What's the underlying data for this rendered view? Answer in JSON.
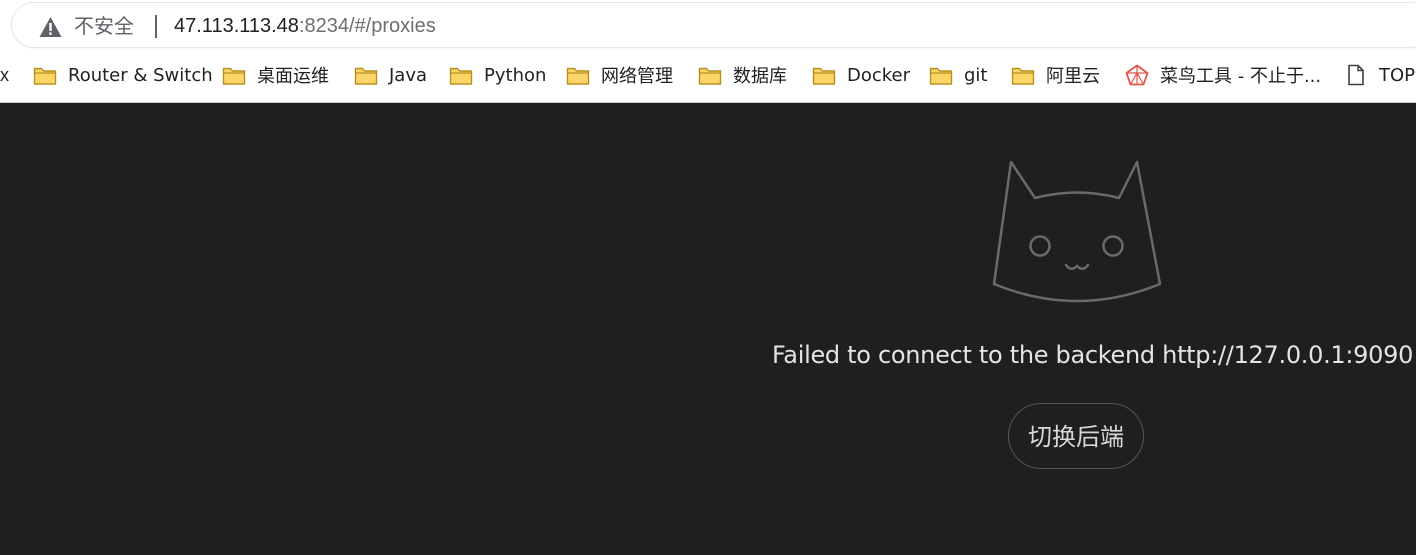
{
  "browser": {
    "security_label": "不安全",
    "url_host": "47.113.113.48",
    "url_rest": ":8234/#/proxies"
  },
  "bookmarks": {
    "leading_fragment": "x",
    "items": [
      {
        "label": "Router & Switch",
        "icon": "folder-icon"
      },
      {
        "label": "桌面运维",
        "icon": "folder-icon"
      },
      {
        "label": "Java",
        "icon": "folder-icon"
      },
      {
        "label": "Python",
        "icon": "folder-icon"
      },
      {
        "label": "网络管理",
        "icon": "folder-icon"
      },
      {
        "label": "数据库",
        "icon": "folder-icon"
      },
      {
        "label": "Docker",
        "icon": "folder-icon"
      },
      {
        "label": "git",
        "icon": "folder-icon"
      },
      {
        "label": "阿里云",
        "icon": "folder-icon"
      },
      {
        "label": "菜鸟工具 - 不止于...",
        "icon": "runoob-icon"
      },
      {
        "label": "TOPS",
        "icon": "page-icon"
      }
    ]
  },
  "main": {
    "error_message": "Failed to connect to the backend http://127.0.0.1:9090",
    "switch_backend_label": "切换后端",
    "logo_icon": "cat-icon"
  },
  "colors": {
    "background": "#1f1f1f",
    "folder_fill": "#fcd669",
    "folder_stroke": "#b8901c",
    "text_light": "#e4e4e4"
  }
}
